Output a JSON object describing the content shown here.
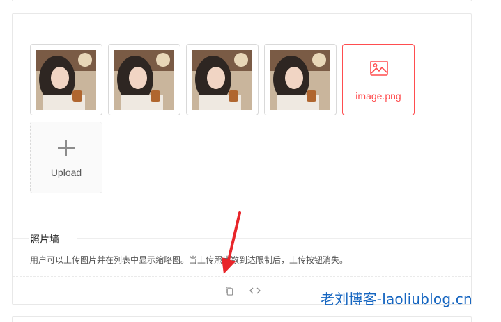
{
  "upload_list": {
    "items": [
      {
        "kind": "image",
        "status": "done"
      },
      {
        "kind": "image",
        "status": "done"
      },
      {
        "kind": "image",
        "status": "done"
      },
      {
        "kind": "image",
        "status": "done"
      },
      {
        "kind": "file",
        "status": "error",
        "name": "image.png"
      }
    ],
    "upload_button_label": "Upload"
  },
  "demo_meta": {
    "title": "照片墙",
    "description": "用户可以上传图片并在列表中显示缩略图。当上传照片数到达限制后，上传按钮消失。"
  },
  "actions": [
    {
      "icon": "copy-icon"
    },
    {
      "icon": "code-expand-icon"
    }
  ],
  "watermark": "老刘博客-laoliublog.cn",
  "colors": {
    "error": "#ff4d4f",
    "border": "#d9d9d9",
    "arrow": "#e8252a",
    "watermark": "#1565c0"
  }
}
